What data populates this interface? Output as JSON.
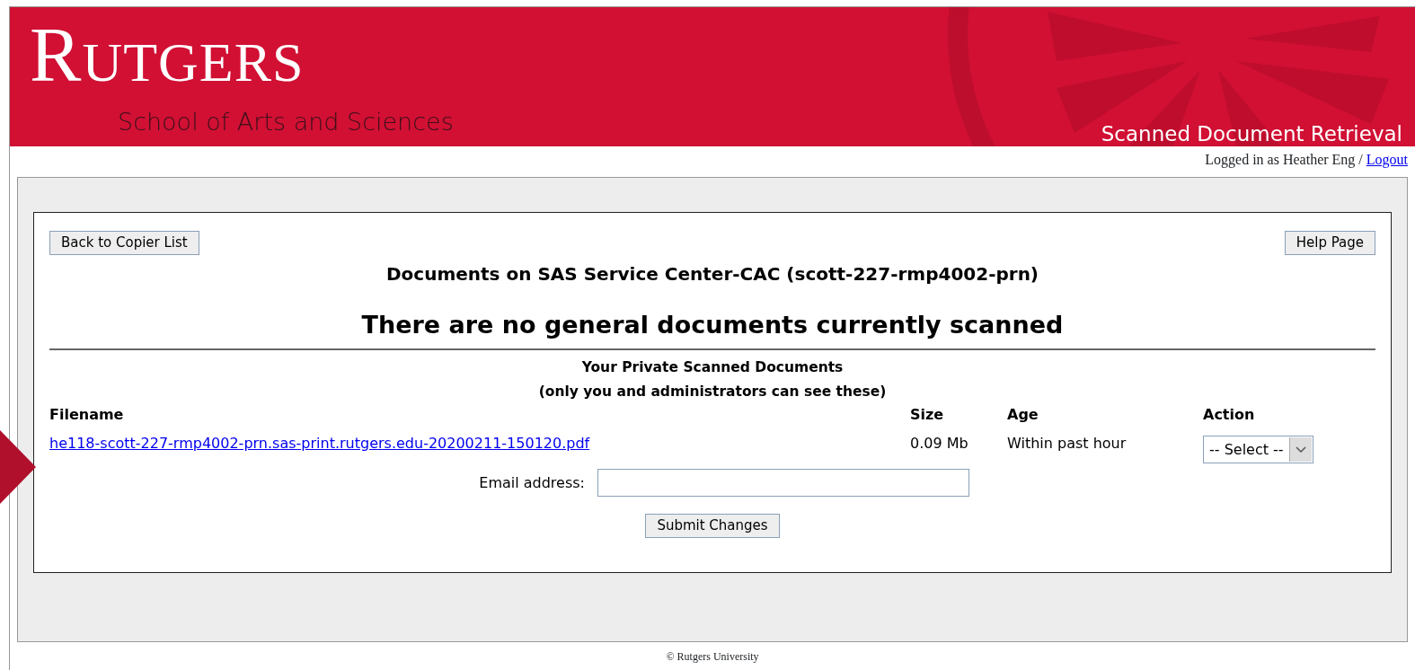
{
  "header": {
    "logo": "RUTGERS",
    "subtitle": "School of Arts and Sciences",
    "app_title": "Scanned Document Retrieval"
  },
  "user_bar": {
    "text": "Logged in as Heather Eng /",
    "logout": "Logout"
  },
  "buttons": {
    "back": "Back to Copier List",
    "help": "Help Page"
  },
  "heading": "Documents on SAS Service Center-CAC (scott-227-rmp4002-prn)",
  "general_notice": "There are no general documents currently scanned",
  "private": {
    "title": "Your Private Scanned Documents",
    "subtitle": "(only you and administrators can see these)"
  },
  "table": {
    "columns": [
      "Filename",
      "Size",
      "Age",
      "Action"
    ],
    "rows": [
      {
        "filename": "he118-scott-227-rmp4002-prn.sas-print.rutgers.edu-20200211-150120.pdf",
        "size": "0.09 Mb",
        "age": "Within past hour",
        "action": "-- Select --"
      }
    ]
  },
  "email": {
    "label": "Email address:"
  },
  "submit": "Submit Changes",
  "footer": "© Rutgers University"
}
